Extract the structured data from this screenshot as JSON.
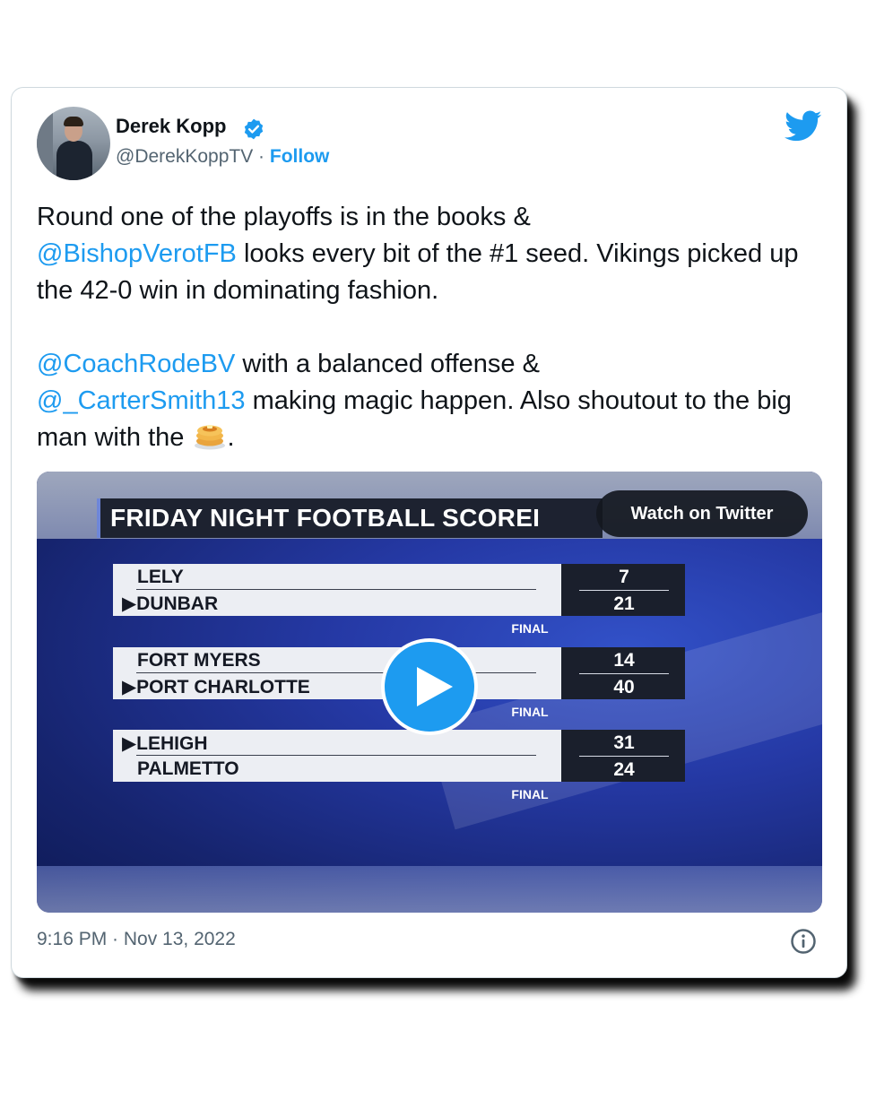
{
  "author": {
    "name": "Derek Kopp",
    "handle": "@DerekKoppTV",
    "separator": " · ",
    "follow_label": "Follow",
    "verified_icon": "verified-badge-icon",
    "avatar_icon": "profile-photo"
  },
  "brand_icon": "twitter-bird-icon",
  "colors": {
    "link": "#1d9bf0",
    "text": "#0f1419",
    "muted": "#536471"
  },
  "tweet": {
    "p1_line1": "Round one of the playoffs is in the books & ",
    "p1_mention": "@BishopVerotFB",
    "p1_rest": " looks every bit of the #1 seed. Vikings picked up the 42-0 win in dominating fashion.",
    "p2_mention1": "@CoachRodeBV",
    "p2_text1": " with a balanced offense & ",
    "p2_mention2": "@_CarterSmith13",
    "p2_text2": " making magic happen. Also shoutout to the big man with the ",
    "p2_emoji": "pancakes-emoji",
    "p2_end": "."
  },
  "media": {
    "header": "FRIDAY NIGHT FOOTBALL SCOREI",
    "watch_label": "Watch on Twitter",
    "play_icon": "play-icon",
    "games": [
      {
        "team1": "LELY",
        "team1_winner": false,
        "team2": "DUNBAR",
        "team2_winner": true,
        "score1": "7",
        "score2": "21",
        "status": "FINAL"
      },
      {
        "team1": "FORT MYERS",
        "team1_winner": false,
        "team2": "PORT CHARLOTTE",
        "team2_winner": true,
        "score1": "14",
        "score2": "40",
        "status": "FINAL"
      },
      {
        "team1": "LEHIGH",
        "team1_winner": true,
        "team2": "PALMETTO",
        "team2_winner": false,
        "score1": "31",
        "score2": "24",
        "status": "FINAL"
      }
    ],
    "winner_marker": "▶"
  },
  "footer": {
    "timestamp": "9:16 PM · Nov 13, 2022",
    "info_icon": "info-icon"
  }
}
